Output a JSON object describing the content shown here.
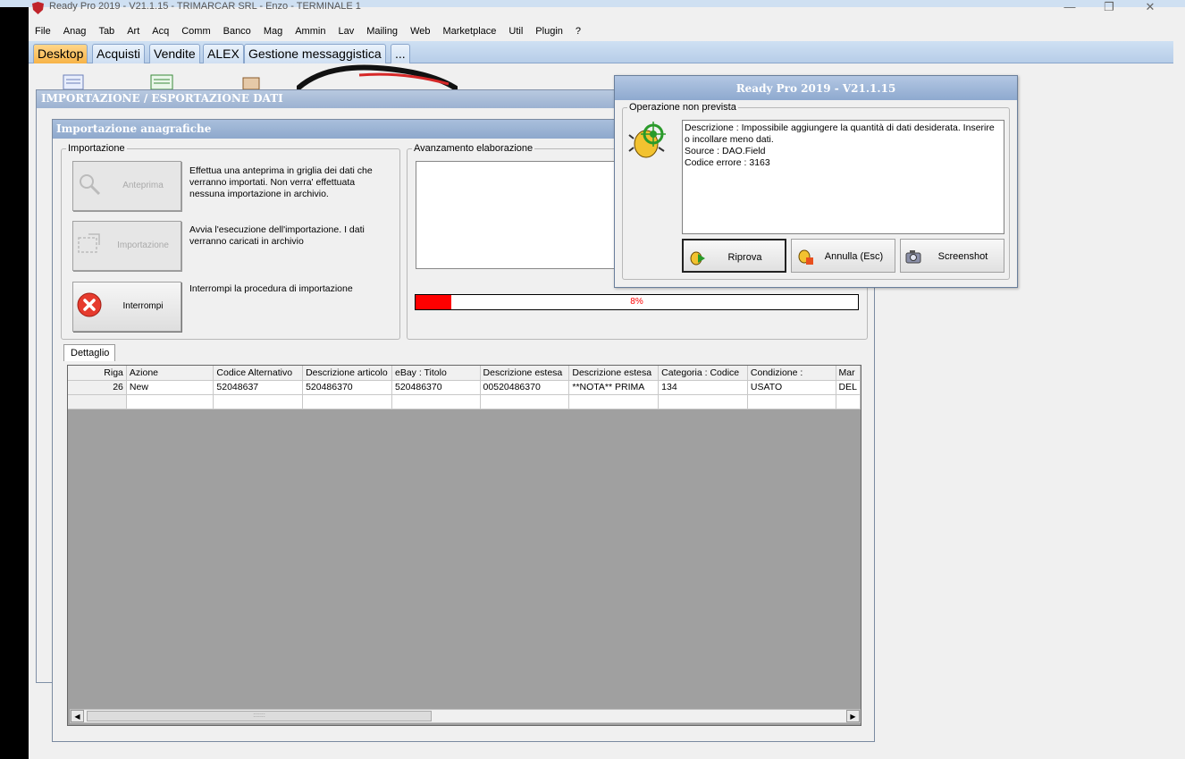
{
  "window": {
    "title": "Ready Pro 2019 - V21.1.15 - TRIMARCAR SRL - Enzo - TERMINALE 1",
    "minimize": "—",
    "maximize": "❐",
    "close": "✕"
  },
  "menu": [
    "File",
    "Anag",
    "Tab",
    "Art",
    "Acq",
    "Comm",
    "Banco",
    "Mag",
    "Ammin",
    "Lav",
    "Mailing",
    "Web",
    "Marketplace",
    "Util",
    "Plugin",
    "?"
  ],
  "tabs": [
    {
      "label": "Desktop",
      "active": true
    },
    {
      "label": "Acquisti",
      "active": false
    },
    {
      "label": "Vendite",
      "active": false
    },
    {
      "label": "ALEX",
      "active": false
    },
    {
      "label": "Gestione messaggistica",
      "active": false
    },
    {
      "label": "...",
      "active": false
    }
  ],
  "bg_window": {
    "title": "IMPORTAZIONE / ESPORTAZIONE DATI"
  },
  "import_window": {
    "title": "Importazione anagrafiche",
    "group_import": "Importazione",
    "group_progress": "Avanzamento elaborazione",
    "btn_preview": "Anteprima",
    "desc_preview": "Effettua una anteprima in griglia dei dati che verranno importati. Non verra' effettuata nessuna importazione in archivio.",
    "btn_import": "Importazione",
    "desc_import": "Avvia l'esecuzione dell'importazione. I dati verranno caricati in archivio",
    "btn_stop": "Interrompi",
    "desc_stop": "Interrompi la procedura di importazione",
    "progress_fraction": 0.08,
    "progress_label": "8%",
    "detail_tab": "Dettaglio"
  },
  "grid": {
    "columns": [
      "Riga",
      "Azione",
      "Codice Alternativo",
      "Descrizione articolo",
      "eBay : Titolo",
      "Descrizione estesa",
      "Descrizione estesa",
      "Categoria : Codice",
      "Condizione :",
      "Mar"
    ],
    "rows": [
      [
        "26",
        "New",
        "52048637",
        "520486370",
        "520486370",
        "00520486370",
        "**NOTA** PRIMA",
        "134",
        "USATO",
        "DEL"
      ]
    ],
    "scroll_grip": ":::::::"
  },
  "error_dialog": {
    "title": "Ready Pro 2019 - V21.1.15",
    "group": "Operazione non prevista",
    "message": [
      "Descrizione : Impossibile aggiungere la quantità di dati desiderata. Inserire o incollare meno dati.",
      "Source : DAO.Field",
      "Codice errore : 3163"
    ],
    "btn_retry": "Riprova",
    "btn_cancel": "Annulla (Esc)",
    "btn_screenshot": "Screenshot"
  },
  "colors": {
    "progress_fill": "#ff0000",
    "active_tab": "#f7b347",
    "caption": "#8ea8cc"
  }
}
